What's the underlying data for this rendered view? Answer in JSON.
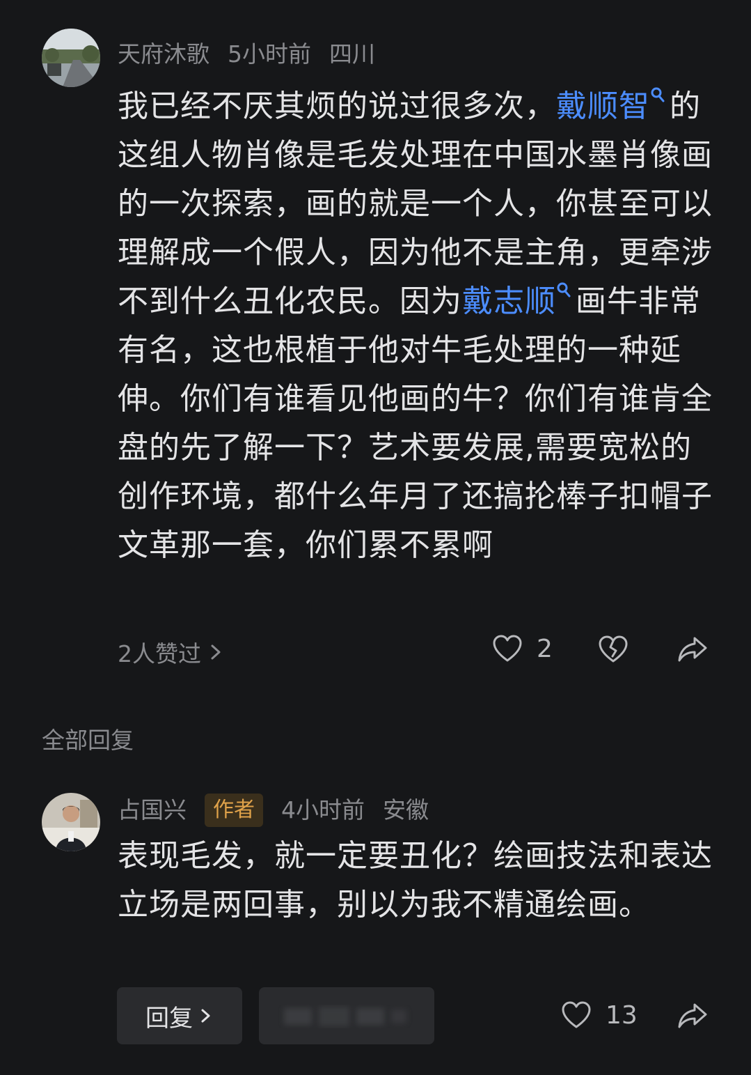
{
  "comment": {
    "username": "天府沐歌",
    "time": "5小时前",
    "location": "四川",
    "body_parts": [
      {
        "type": "text",
        "value": "我已经不厌其烦的说过很多次，"
      },
      {
        "type": "link",
        "value": "戴顺智"
      },
      {
        "type": "text",
        "value": "的这组人物肖像是毛发处理在中国水墨肖像画的一次探索，画的就是一个人，你甚至可以理解成一个假人，因为他不是主角，更牵涉不到什么丑化农民。因为"
      },
      {
        "type": "link",
        "value": "戴志顺"
      },
      {
        "type": "text",
        "value": "画牛非常有名，这也根植于他对牛毛处理的一种延伸。你们有谁看见他画的牛？你们有谁肯全盘的先了解一下？艺术要发展,需要宽松的创作环境，都什么年月了还搞抡棒子扣帽子文革那一套，你们累不累啊"
      }
    ],
    "likes_summary": "2人赞过",
    "like_count": "2"
  },
  "replies_section_title": "全部回复",
  "reply": {
    "username": "占国兴",
    "badge": "作者",
    "time": "4小时前",
    "location": "安徽",
    "body": "表现毛发，就一定要丑化？绘画技法和表达立场是两回事，别以为我不精通绘画。",
    "reply_button": "回复",
    "like_count": "13"
  },
  "colors": {
    "background": "#161719",
    "link": "#4c8dff",
    "badge_text": "#e0a24a",
    "muted": "#8a8b8f"
  },
  "icons": [
    "heart-icon",
    "broken-heart-icon",
    "share-icon",
    "chevron-right-icon",
    "search-icon"
  ]
}
